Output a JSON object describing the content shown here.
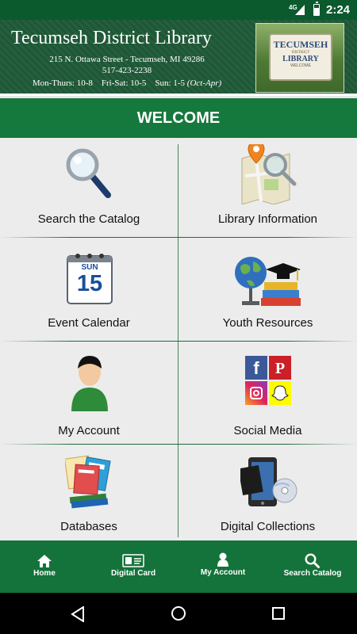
{
  "status_bar": {
    "network": "4G",
    "time": "2:24"
  },
  "banner": {
    "title": "Tecumseh District Library",
    "address": "215 N. Ottawa Street - Tecumseh, MI 49286",
    "phone": "517-423-2238",
    "hours": "Mon-Thurs: 10-8    Fri-Sat: 10-5    Sun: 1-5",
    "hours_note": "(Oct-Apr)",
    "sign_text": [
      "TECUMSEH",
      "DISTRICT",
      "LIBRARY",
      "WELCOME"
    ]
  },
  "welcome": "WELCOME",
  "tiles": [
    {
      "label": "Search the Catalog",
      "icon": "magnifier-icon"
    },
    {
      "label": "Library Information",
      "icon": "map-magnifier-icon"
    },
    {
      "label": "Event Calendar",
      "icon": "calendar-icon",
      "calendar_day": "SUN",
      "calendar_date": "15"
    },
    {
      "label": "Youth Resources",
      "icon": "globe-books-icon"
    },
    {
      "label": "My Account",
      "icon": "person-icon"
    },
    {
      "label": "Social Media",
      "icon": "social-media-icon",
      "social": [
        "f",
        "P"
      ]
    },
    {
      "label": "Databases",
      "icon": "magazines-icon"
    },
    {
      "label": "Digital Collections",
      "icon": "devices-icon"
    }
  ],
  "bottom_nav": [
    {
      "label": "Home",
      "icon": "home-icon"
    },
    {
      "label": "Digital Card",
      "icon": "card-icon"
    },
    {
      "label": "My Account",
      "icon": "person-icon"
    },
    {
      "label": "Search Catalog",
      "icon": "search-icon"
    }
  ],
  "colors": {
    "brand_green": "#15783c",
    "status_green": "#0b5a2e"
  }
}
